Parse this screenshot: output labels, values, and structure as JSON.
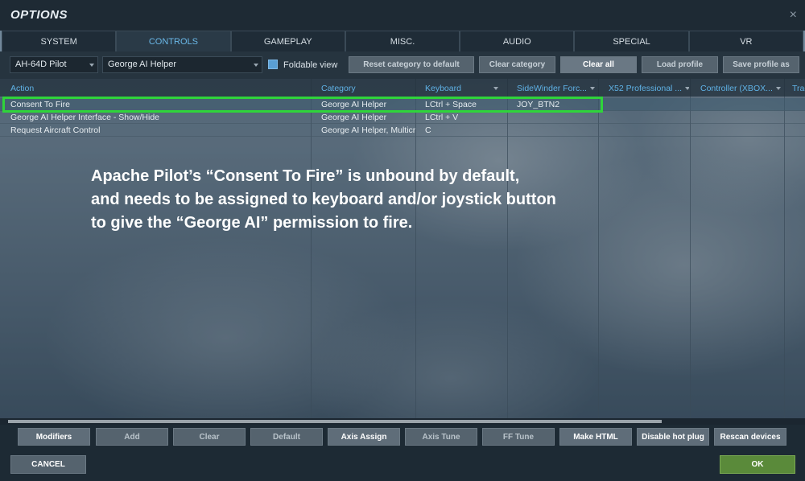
{
  "window": {
    "title": "OPTIONS",
    "close_glyph": "×"
  },
  "tabs": [
    {
      "label": "SYSTEM"
    },
    {
      "label": "CONTROLS"
    },
    {
      "label": "GAMEPLAY"
    },
    {
      "label": "MISC."
    },
    {
      "label": "AUDIO"
    },
    {
      "label": "SPECIAL"
    },
    {
      "label": "VR"
    }
  ],
  "active_tab": "CONTROLS",
  "toolbar": {
    "aircraft_select": "AH-64D Pilot",
    "category_select": "George AI Helper",
    "foldable_label": "Foldable view",
    "foldable_checked": true,
    "reset_category": "Reset category to default",
    "clear_category": "Clear category",
    "clear_all": "Clear all",
    "load_profile": "Load profile",
    "save_profile_as": "Save profile as"
  },
  "columns": [
    "Action",
    "Category",
    "Keyboard",
    "SideWinder Forc...",
    "X52 Professional ...",
    "Controller (XBOX...",
    "Trac"
  ],
  "rows": [
    {
      "action": "Consent To Fire",
      "category": "George AI Helper",
      "keyboard": "LCtrl + Space",
      "sidewinder": "JOY_BTN2"
    },
    {
      "action": "George AI Helper Interface - Show/Hide",
      "category": "George AI Helper",
      "keyboard": "LCtrl + V",
      "sidewinder": ""
    },
    {
      "action": "Request Aircraft Control",
      "category": "George AI Helper, Multicre",
      "keyboard": "C",
      "sidewinder": ""
    }
  ],
  "annotation": {
    "line1": "Apache Pilot’s “Consent To Fire” is unbound by default,",
    "line2": "and needs to be assigned to keyboard and/or joystick button",
    "line3": "to give the “George AI” permission to fire.",
    "highlight_color": "#2fd43a"
  },
  "bottom_buttons": {
    "modifiers": "Modifiers",
    "add": "Add",
    "clear": "Clear",
    "default": "Default",
    "axis_assign": "Axis Assign",
    "axis_tune": "Axis Tune",
    "ff_tune": "FF Tune",
    "make_html": "Make HTML",
    "disable_hot_plug": "Disable hot plug",
    "rescan_devices": "Rescan devices"
  },
  "footer": {
    "cancel": "CANCEL",
    "ok": "OK"
  },
  "colors": {
    "accent": "#6ab8e8",
    "ok_green": "#5a8a3a"
  }
}
